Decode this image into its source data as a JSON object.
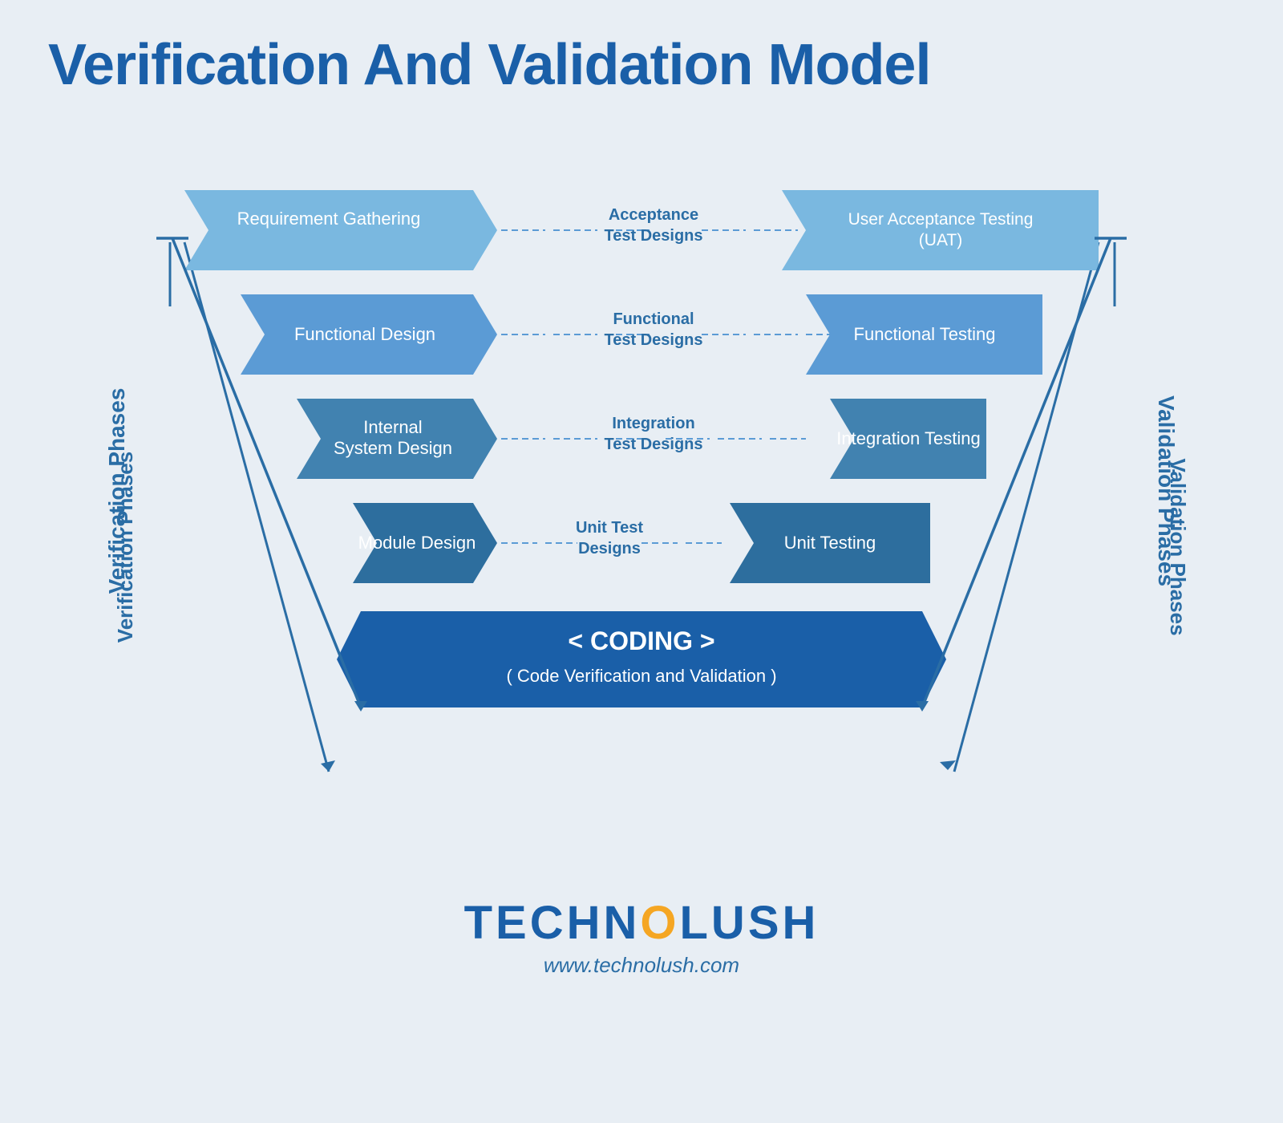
{
  "title": "Verification And Validation Model",
  "diagram": {
    "left_blocks": [
      {
        "label": "Requirement Gathering",
        "row": 1
      },
      {
        "label": "Functional Design",
        "row": 2
      },
      {
        "label": "Internal System Design",
        "row": 3
      },
      {
        "label": "Module Design",
        "row": 4
      }
    ],
    "right_blocks": [
      {
        "label": "User Acceptance Testing (UAT)",
        "row": 1
      },
      {
        "label": "Functional Testing",
        "row": 2
      },
      {
        "label": "Integration Testing",
        "row": 3
      },
      {
        "label": "Unit Testing",
        "row": 4
      }
    ],
    "center_labels": [
      {
        "label": "Acceptance\nTest Designs",
        "row": 1
      },
      {
        "label": "Functional\nTest Designs",
        "row": 2
      },
      {
        "label": "Integration\nTest Designs",
        "row": 3
      },
      {
        "label": "Unit Test\nDesigns",
        "row": 4
      }
    ],
    "bottom_block": {
      "line1": "< CODING >",
      "line2": "( Code Verification and Validation )"
    },
    "verification_label": "Verification  Phases",
    "validation_label": "Validation  Phases"
  },
  "footer": {
    "brand_prefix": "TECHN",
    "brand_o": "O",
    "brand_suffix": "LUSH",
    "url": "www.technolush.com"
  },
  "colors": {
    "title": "#1a5fa8",
    "block_light": "#6aabd8",
    "block_mid": "#4a8fc2",
    "block_dark": "#2a6da5",
    "block_deep": "#1a5fa8",
    "bottom_block": "#1a5fa8",
    "dashed": "#5b9bd5",
    "center_text": "#2a6da5",
    "brand_main": "#1a5fa8",
    "brand_o": "#f5a623"
  }
}
